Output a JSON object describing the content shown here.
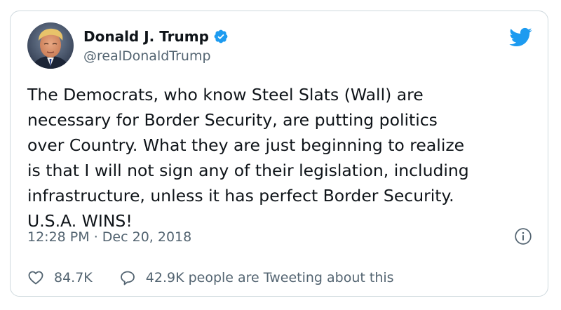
{
  "tweet": {
    "author": {
      "display_name": "Donald J. Trump",
      "handle": "@realDonaldTrump",
      "verified": true,
      "avatar_icon": "profile-photo"
    },
    "brand": {
      "logo_icon": "twitter-bird-icon",
      "accent_color": "#1d9bf0"
    },
    "text_lines": [
      "The Democrats, who know Steel Slats (Wall) are",
      "necessary for Border Security, are putting politics",
      "over Country. What they are just beginning to realize",
      "is that I will not sign any of their legislation, including",
      "infrastructure, unless it has perfect Border Security.",
      "U.S.A. WINS!"
    ],
    "time": "12:28 PM",
    "separator": "·",
    "date": "Dec 20, 2018",
    "info_icon": "info-icon",
    "likes": "84.7K",
    "conversation": "42.9K people are Tweeting about this"
  },
  "colors": {
    "text_primary": "#0f1419",
    "text_secondary": "#536471",
    "border": "#cfd9de",
    "verified_blue": "#1d9bf0"
  }
}
